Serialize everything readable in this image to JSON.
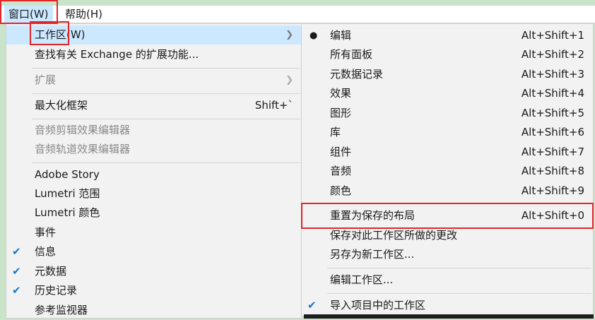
{
  "menubar": {
    "window": "窗口(W)",
    "help": "帮助(H)"
  },
  "window_menu": {
    "workspace": "工作区(W)",
    "find_exchange": "查找有关 Exchange 的扩展功能...",
    "extensions": "扩展",
    "maximize": "最大化框架",
    "maximize_shortcut": "Shift+`",
    "audio_clip_fx": "音频剪辑效果编辑器",
    "audio_track_fx": "音频轨道效果编辑器",
    "adobe_story": "Adobe Story",
    "lumetri_scopes": "Lumetri 范围",
    "lumetri_color": "Lumetri 颜色",
    "events": "事件",
    "info": "信息",
    "metadata": "元数据",
    "history": "历史记录",
    "reference_monitor": "参考监视器"
  },
  "workspace_menu": {
    "items": [
      {
        "label": "编辑",
        "shortcut": "Alt+Shift+1"
      },
      {
        "label": "所有面板",
        "shortcut": "Alt+Shift+2"
      },
      {
        "label": "元数据记录",
        "shortcut": "Alt+Shift+3"
      },
      {
        "label": "效果",
        "shortcut": "Alt+Shift+4"
      },
      {
        "label": "图形",
        "shortcut": "Alt+Shift+5"
      },
      {
        "label": "库",
        "shortcut": "Alt+Shift+6"
      },
      {
        "label": "组件",
        "shortcut": "Alt+Shift+7"
      },
      {
        "label": "音频",
        "shortcut": "Alt+Shift+8"
      },
      {
        "label": "颜色",
        "shortcut": "Alt+Shift+9"
      }
    ],
    "reset_layout": "重置为保存的布局",
    "reset_shortcut": "Alt+Shift+0",
    "save_changes": "保存对此工作区所做的更改",
    "save_as_new": "另存为新工作区...",
    "edit_workspaces": "编辑工作区...",
    "import_from_project": "导入项目中的工作区"
  },
  "icons": {
    "submenu": "chevron-right-icon",
    "selected": "bullet-dot-icon",
    "checked": "checkmark-icon"
  },
  "colors": {
    "highlight": "#cce8ff",
    "annotation": "#e0262b",
    "check": "#1976c8"
  }
}
